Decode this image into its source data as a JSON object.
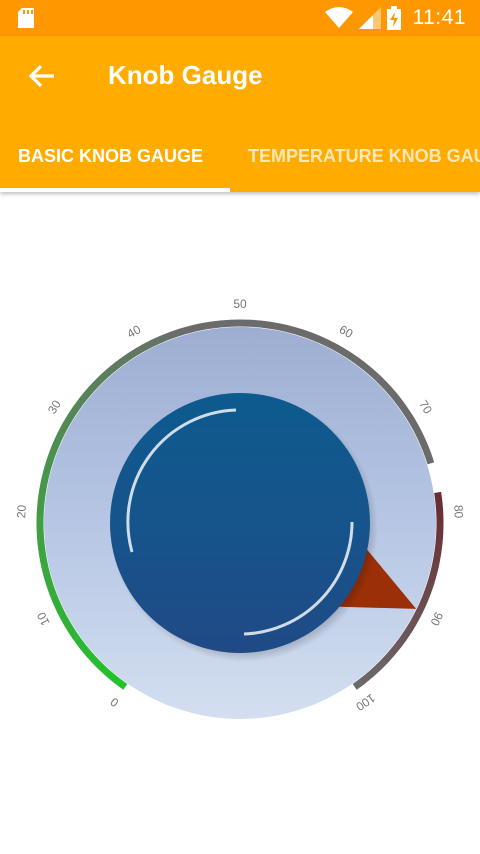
{
  "status_bar": {
    "time": "11:41",
    "icons": [
      "sd-card-icon",
      "wifi-icon",
      "signal-icon",
      "battery-charging-icon"
    ]
  },
  "app_bar": {
    "title": "Knob Gauge",
    "back_icon": "arrow-back-icon",
    "color": "#ffab00"
  },
  "tabs": [
    {
      "label": "BASIC KNOB GAUGE",
      "selected": true
    },
    {
      "label": "TEMPERATURE KNOB GAUGE",
      "selected": false
    }
  ],
  "gauge": {
    "min": 0,
    "max": 100,
    "value": 90,
    "tick_labels": [
      "0",
      "10",
      "20",
      "30",
      "40",
      "50",
      "60",
      "70",
      "80",
      "90",
      "100"
    ],
    "range_colors": {
      "green": "#22c32a",
      "gray": "#6b6b6b",
      "maroon": "#6a2b30",
      "knob": "#15568a",
      "pointer": "#9b2f08"
    }
  }
}
